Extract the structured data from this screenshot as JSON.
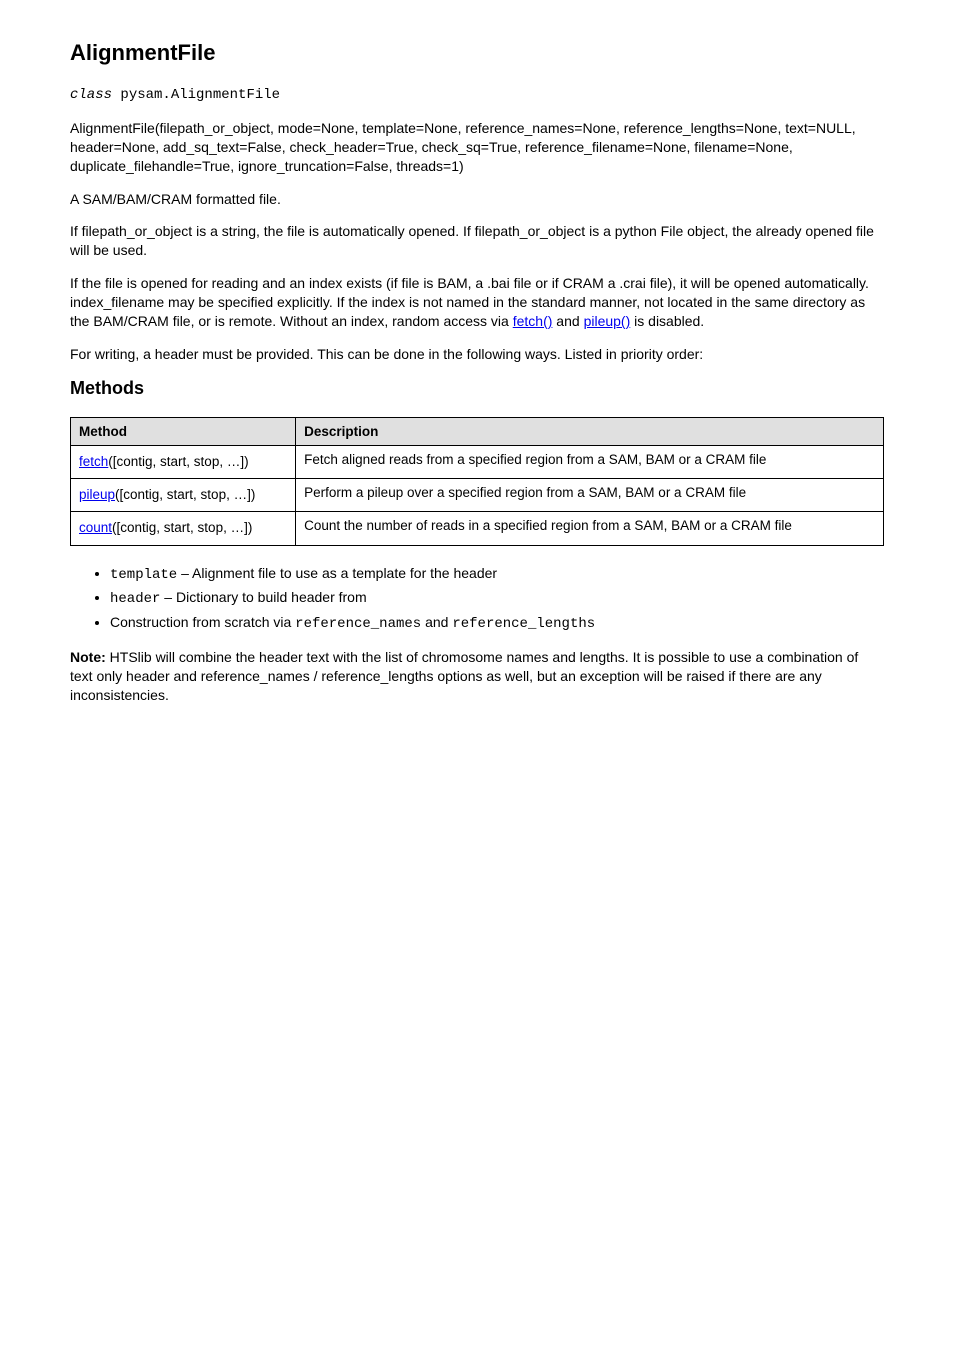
{
  "header": {
    "title": "AlignmentFile"
  },
  "classdef": {
    "label": "class",
    "signature": "pysam.AlignmentFile"
  },
  "intro": {
    "p1_part1": "AlignmentFile(filepath_or_object, mode=None, template=None, reference_names=None, reference_lengths=None, text=NULL, header=None, add_sq_text=False, check_header=True, check_sq=True, reference_filename=None, filename=None, duplicate_filehandle=True, ignore_truncation=False, threads=1)",
    "p2": "A SAM/BAM/CRAM formatted file.",
    "p3_part1": "If filepath_or_object is a string, the file is automatically opened. If filepath_or_object is a python File object, the already opened file will be used.",
    "p4": "If the file is opened for reading and an index exists (if file is BAM, a .bai file or if CRAM a .crai file), it will be opened automatically. index_filename may be specified explicitly. If the index is not named in the standard manner, not located in the same directory as the BAM/CRAM file, or is remote. Without an index, random access via ",
    "method_fetch": "fetch()",
    "p4_b": " and ",
    "method_pileup": "pileup()",
    "p4_c": " is disabled.",
    "p5": "For writing, a header must be provided. This can be done in the following ways. Listed in priority order:"
  },
  "table": {
    "header_method": "Method",
    "header_description": "Description",
    "rows": [
      {
        "method_link": "fetch",
        "method_args": "([contig, start, stop, …])",
        "description": "Fetch aligned reads from a specified region from a SAM, BAM or a CRAM file"
      },
      {
        "method_link": "pileup",
        "method_args": "([contig, start, stop, …])",
        "description": "Perform a pileup over a specified region from a SAM, BAM or a CRAM file"
      },
      {
        "method_link": "count",
        "method_args": "([contig, start, stop, …])",
        "description": "Count the number of reads in a specified region from a SAM, BAM or a CRAM file"
      }
    ]
  },
  "list": {
    "items": [
      {
        "pre": "",
        "mono": "template",
        "post": " – Alignment file to use as a template for the header"
      },
      {
        "pre": "",
        "mono": "header",
        "post": " – Dictionary to build header from"
      },
      {
        "pre": "Construction from scratch via ",
        "mono": "reference_names",
        "mid": " and ",
        "mono2": "reference_lengths",
        "post": ""
      }
    ]
  },
  "note": {
    "label": "Note:",
    "body": "HTSlib will combine the header text with the list of chromosome names and lengths. It is possible to use a combination of text only header and reference_names / reference_lengths options as well, but an exception will be raised if there are any inconsistencies."
  }
}
